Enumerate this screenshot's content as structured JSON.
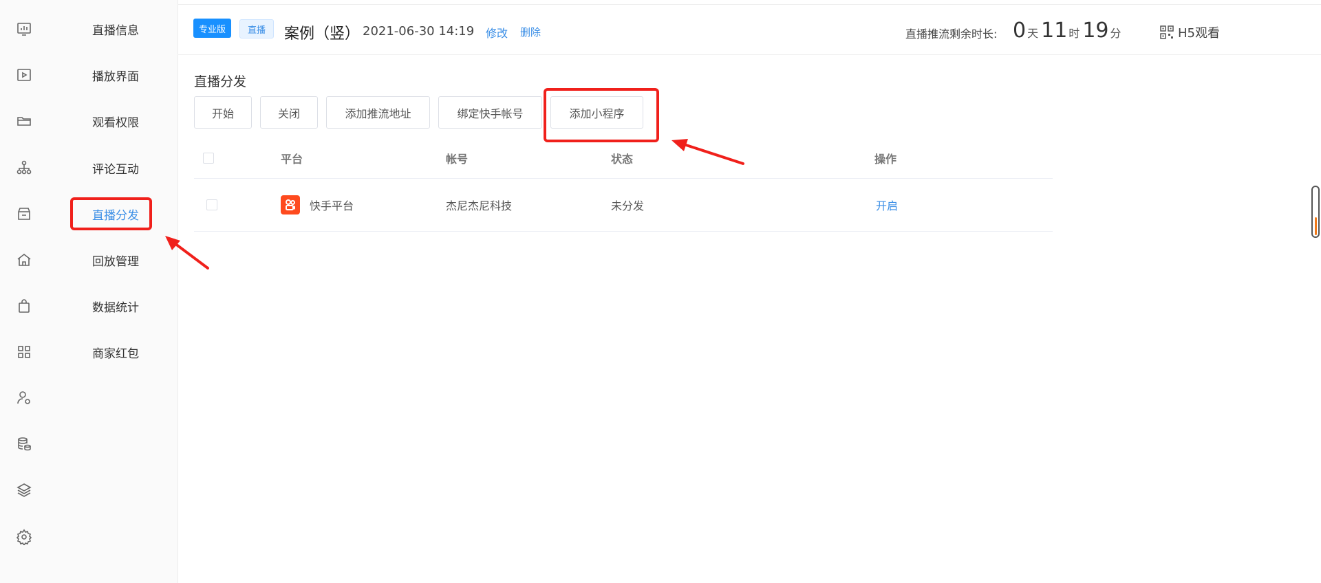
{
  "rail": {
    "icons": [
      "chart-icon",
      "video-icon",
      "folder-icon",
      "org-icon",
      "store-icon",
      "home-icon",
      "bag-icon",
      "apps-icon",
      "user-settings-icon",
      "database-icon",
      "layers-icon",
      "gear-icon"
    ]
  },
  "menu": {
    "items": [
      {
        "label": "直播信息"
      },
      {
        "label": "播放界面"
      },
      {
        "label": "观看权限"
      },
      {
        "label": "评论互动"
      },
      {
        "label": "直播分发"
      },
      {
        "label": "回放管理"
      },
      {
        "label": "数据统计"
      },
      {
        "label": "商家红包"
      }
    ],
    "active_index": 4
  },
  "header": {
    "badge_pro": "专业版",
    "badge_live": "直播",
    "title": "案例（竖）",
    "date": "2021-06-30 14:19",
    "edit": "修改",
    "delete": "删除",
    "remain_label": "直播推流剩余时长:",
    "remain_days": "0",
    "unit_day": "天",
    "remain_hours": "11",
    "unit_hour": "时",
    "remain_minutes": "19",
    "unit_minute": "分",
    "h5": "H5观看"
  },
  "section": {
    "title": "直播分发",
    "buttons": {
      "start": "开始",
      "close": "关闭",
      "add_push": "添加推流地址",
      "bind_kuaishou": "绑定快手帐号",
      "add_miniprogram": "添加小程序"
    }
  },
  "table": {
    "headers": {
      "platform": "平台",
      "account": "帐号",
      "status": "状态",
      "action": "操作"
    },
    "rows": [
      {
        "platform": "快手平台",
        "account": "杰尼杰尼科技",
        "status": "未分发",
        "action": "开启"
      }
    ]
  },
  "colors": {
    "accent": "#3a8ee6",
    "highlight": "#f0201b",
    "kuaishou": "#fe4a1e"
  }
}
